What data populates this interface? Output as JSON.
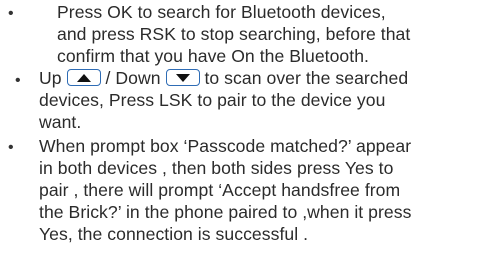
{
  "instructions": [
    {
      "lines": [
        "Press OK to search for Bluetooth devices,",
        "and press RSK to stop searching, before that",
        "confirm that you have On the Bluetooth."
      ]
    },
    {
      "line1_prefix": "Up",
      "line1_sep": "/ Down",
      "line1_suffix": "to scan over the searched",
      "lines": [
        "devices, Press LSK to pair to the device you",
        "want."
      ],
      "up_key_icon": "triangle-up-icon",
      "down_key_icon": "triangle-down-icon"
    },
    {
      "lines": [
        "When prompt box ‘Passcode matched?’ appear",
        "in both  devices , then both sides press Yes to",
        "pair , there will prompt ‘Accept handsfree from",
        "the Brick?’ in the phone paired to ,when it press",
        "Yes, the connection is successful ."
      ]
    }
  ],
  "bullet_char": "•",
  "colors": {
    "text": "#2b2b2b",
    "key_border": "#2e6cb5",
    "key_glyph": "#111111"
  }
}
